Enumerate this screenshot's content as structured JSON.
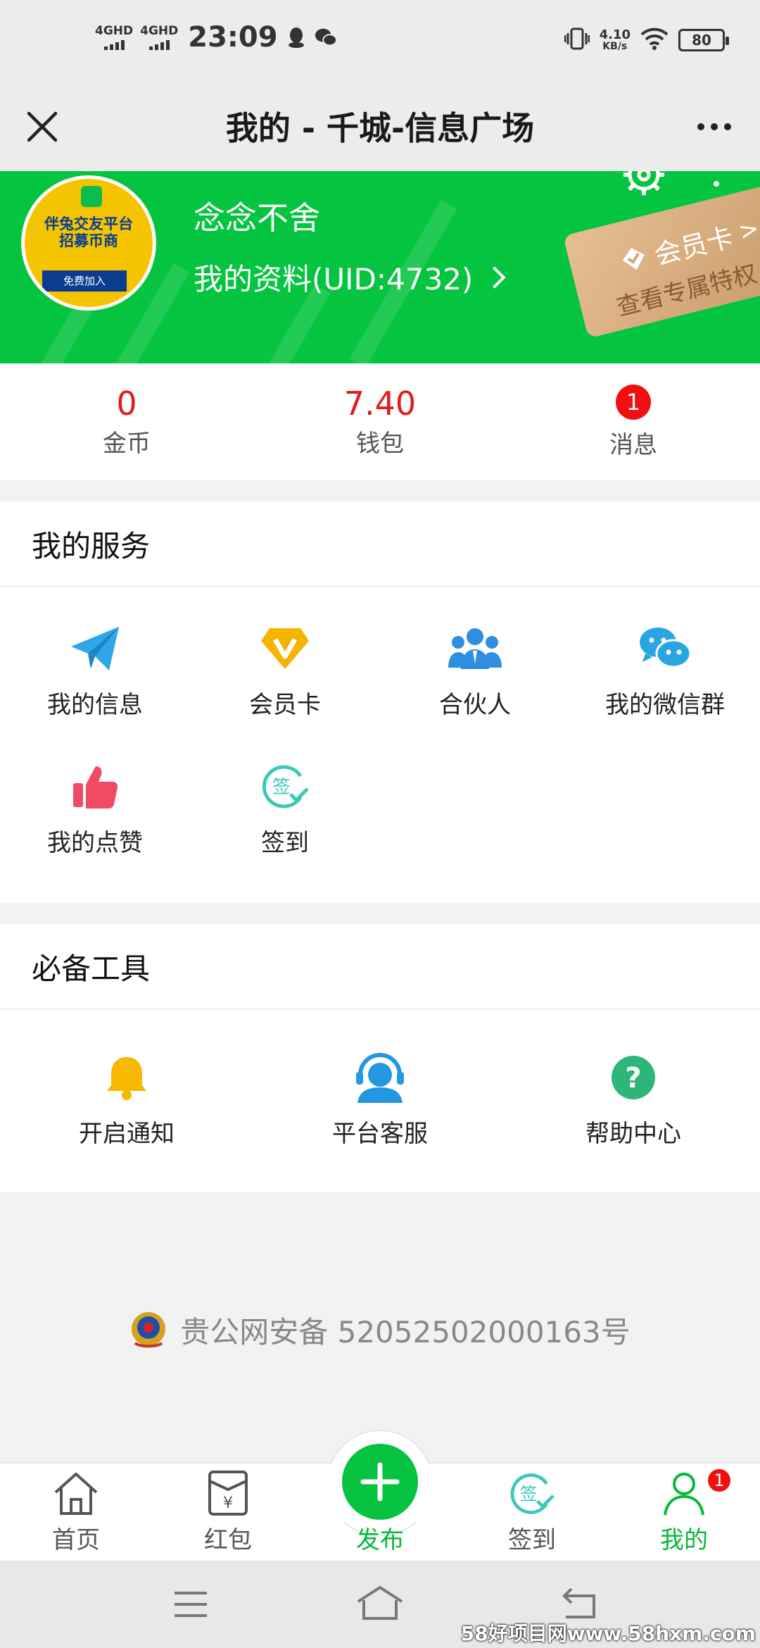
{
  "status_bar": {
    "network1": "4GHD",
    "network2": "4GHD",
    "time": "23:09",
    "speed_value": "4.10",
    "speed_unit": "KB/s",
    "battery": "80"
  },
  "title_bar": {
    "title": "我的 - 千城-信息广场"
  },
  "profile": {
    "username": "念念不舍",
    "link_text": "我的资料(UID:4732)",
    "avatar_line1": "伴兔交友平台",
    "avatar_line2": "招募币商",
    "avatar_line3": "免费加入",
    "vip_title": "会员卡",
    "vip_subtitle": "查看专属特权"
  },
  "stats": {
    "coins_value": "0",
    "coins_label": "金币",
    "wallet_value": "7.40",
    "wallet_label": "钱包",
    "messages_badge": "1",
    "messages_label": "消息"
  },
  "services": {
    "title": "我的服务",
    "items": [
      {
        "label": "我的信息",
        "icon": "paper-plane-icon"
      },
      {
        "label": "会员卡",
        "icon": "vip-diamond-icon"
      },
      {
        "label": "合伙人",
        "icon": "partners-icon"
      },
      {
        "label": "我的微信群",
        "icon": "wechat-icon"
      },
      {
        "label": "我的点赞",
        "icon": "thumbs-up-icon"
      },
      {
        "label": "签到",
        "icon": "checkin-icon"
      }
    ]
  },
  "tools": {
    "title": "必备工具",
    "items": [
      {
        "label": "开启通知",
        "icon": "bell-icon"
      },
      {
        "label": "平台客服",
        "icon": "customer-service-icon"
      },
      {
        "label": "帮助中心",
        "icon": "help-icon"
      }
    ]
  },
  "footer": {
    "icp": "贵公网安备 52052502000163号"
  },
  "bottom_nav": {
    "items": [
      {
        "label": "首页"
      },
      {
        "label": "红包"
      },
      {
        "label": "发布"
      },
      {
        "label": "签到"
      },
      {
        "label": "我的"
      }
    ],
    "mine_badge": "1"
  },
  "watermark": "58好项目网www.58hxm.com",
  "colors": {
    "brand_green": "#05c43f",
    "alert_red": "#e21b1b",
    "badge_red": "#f01010"
  }
}
